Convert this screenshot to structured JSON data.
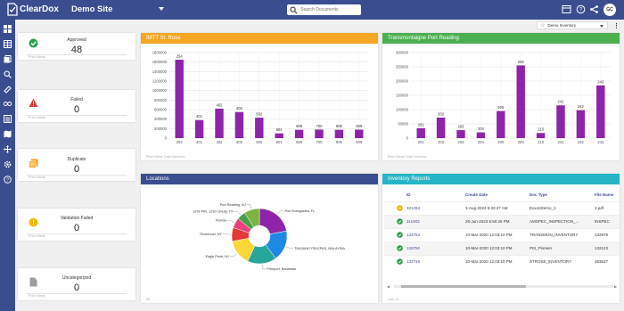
{
  "app": {
    "brand": "ClearDox",
    "site": "Demo Site",
    "search_placeholder": "Search Documents",
    "avatar": "GC"
  },
  "toolbar_icons": [
    "table-icon",
    "help-icon",
    "share-icon",
    "more-icon"
  ],
  "sidebar_icons": [
    "dashboard-icon",
    "grid-icon",
    "documents-icon",
    "search-icon",
    "link-icon",
    "workflow-icon",
    "list-icon",
    "map-icon",
    "move-icon",
    "settings-icon",
    "help-icon"
  ],
  "dashboard_selector": {
    "value": "Demo Inventory"
  },
  "cards": [
    {
      "title": "Approved",
      "value": "48",
      "footer": "Prior Week",
      "icon": "check-circle-icon",
      "color": "#2e9e4e"
    },
    {
      "title": "Failed",
      "value": "0",
      "footer": "Prior Week",
      "icon": "warning-triangle-icon",
      "color": "#e53935"
    },
    {
      "title": "Duplicate",
      "value": "0",
      "footer": "Prior Week",
      "icon": "duplicate-icon",
      "color": "#f39c12"
    },
    {
      "title": "Validation Failed",
      "value": "0",
      "footer": "Prior Week",
      "icon": "alert-circle-icon",
      "color": "#f5b800"
    },
    {
      "title": "Uncategorized",
      "value": "0",
      "footer": "Prior Week",
      "icon": "file-icon",
      "color": "#9e9e9e"
    }
  ],
  "panels": {
    "p1": {
      "title": "IMTT St. Rose",
      "footer": "Prior Week Total Volumes",
      "color": "#f5a623"
    },
    "p2": {
      "title": "Transmontaigne Port Reading",
      "footer": "Prior Week Total Volumes",
      "color": "#4caf50"
    },
    "p3": {
      "title": "Locations",
      "footer": "All",
      "color": "#3a4d8f"
    },
    "p4": {
      "title": "Inventory Reports",
      "footer": "Last 10",
      "color": "#26b5c7"
    }
  },
  "chart_data": [
    {
      "type": "bar",
      "title": "IMTT St. Rose",
      "categories": [
        "254",
        "401",
        "402",
        "403",
        "502",
        "601",
        "699",
        "700",
        "905",
        "909"
      ],
      "data_labels": [
        "254",
        "401",
        "402",
        "403",
        "502",
        "601",
        "699",
        "700",
        "905",
        "909"
      ],
      "values": [
        1650000,
        380000,
        620000,
        550000,
        430000,
        100000,
        175000,
        180000,
        175000,
        178000
      ],
      "ylim": [
        0,
        1800000
      ],
      "yticks": [
        0,
        200000,
        400000,
        600000,
        800000,
        1000000,
        1200000,
        1400000,
        1600000,
        1800000
      ],
      "color": "#8e24aa",
      "grid": true
    },
    {
      "type": "bar",
      "title": "Transmontaigne Port Reading",
      "categories": [
        "201",
        "202",
        "203",
        "204",
        "205",
        "206",
        "210",
        "241",
        "242",
        "243"
      ],
      "data_labels": [
        "201",
        "202",
        "203",
        "204",
        "205",
        "206",
        "210",
        "241",
        "242",
        "243"
      ],
      "values": [
        35000,
        72000,
        28000,
        20000,
        95000,
        255000,
        18000,
        115000,
        98000,
        185000
      ],
      "ylim": [
        0,
        300000
      ],
      "yticks": [
        0,
        50000,
        100000,
        150000,
        200000,
        250000,
        300000
      ],
      "color": "#8e24aa",
      "grid": true
    },
    {
      "type": "pie",
      "title": "Locations",
      "donut": true,
      "slices": [
        {
          "label": "Port Everglades, FL",
          "value": 22,
          "color": "#8e24aa"
        },
        {
          "label": "TANJUNG PELEPAS, MALAYSIA",
          "value": 18,
          "color": "#1e88e5"
        },
        {
          "label": "Freeport, Bahamas",
          "value": 17,
          "color": "#26a69a"
        },
        {
          "label": "Eagle Point, NJ",
          "value": 15,
          "color": "#fdd835"
        },
        {
          "label": "Riverhead, NY",
          "value": 8,
          "color": "#e53935"
        },
        {
          "label": "Florida",
          "value": 6,
          "color": "#ec407a"
        },
        {
          "label": "1078 PIN. 1230 Liberty, TX",
          "value": 5,
          "color": "#43a047"
        },
        {
          "label": "Port Reading, NJ",
          "value": 9,
          "color": "#7cb342"
        }
      ]
    }
  ],
  "table": {
    "columns": [
      "",
      "ID",
      "Create Date",
      "Doc Type",
      "File Name"
    ],
    "rows": [
      {
        "status": "pending",
        "id": "321264",
        "date": "3-Aug-2023 6:33:47 AM",
        "doc_type": "ExxonDemo_1",
        "file": "3.pdf"
      },
      {
        "status": "approved",
        "id": "311903",
        "date": "28-Jun-2023 6:50:28 PM",
        "doc_type": "AMSPEC_INSPECTION_...",
        "file": "INSPEC"
      },
      {
        "status": "approved",
        "id": "133753",
        "date": "10-Mar-2020 12:03:10 PM",
        "doc_type": "TRANSMON_INVENTORY",
        "file": "132979"
      },
      {
        "status": "approved",
        "id": "133750",
        "date": "10-Mar-2020 12:03:10 PM",
        "doc_type": "PIS_Pioneer",
        "file": "132123"
      },
      {
        "status": "approved",
        "id": "133749",
        "date": "10-Mar-2020 12:03:10 PM",
        "doc_type": "STROSE_INVENTORY",
        "file": "463637"
      }
    ]
  }
}
